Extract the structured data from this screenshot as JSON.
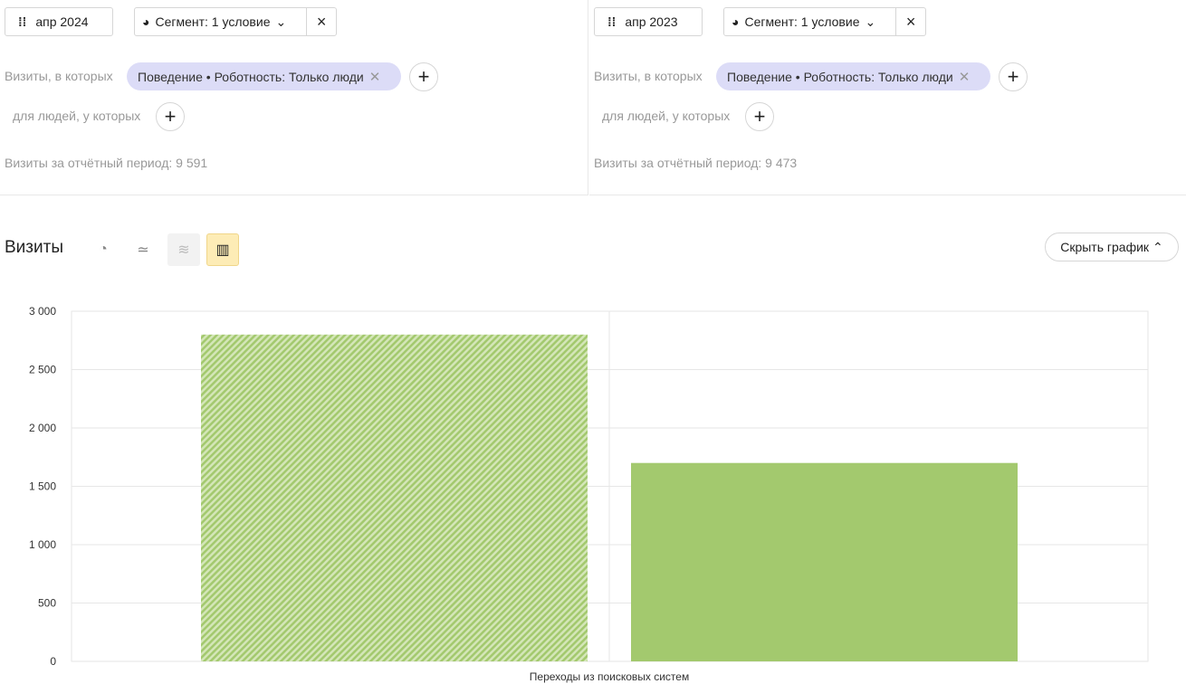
{
  "panels": [
    {
      "date": "апр 2024",
      "segment": "Сегмент: 1 условие",
      "visits_where": "Визиты, в которых",
      "chip": "Поведение • Роботность: Только люди",
      "people_where": "для людей, у которых",
      "total": "Визиты за отчётный период: 9 591"
    },
    {
      "date": "апр 2023",
      "segment": "Сегмент: 1 условие",
      "visits_where": "Визиты, в которых",
      "chip": "Поведение • Роботность: Только люди",
      "people_where": "для людей, у которых",
      "total": "Визиты за отчётный период: 9 473"
    }
  ],
  "chart_header": {
    "title": "Визиты",
    "hide_label": "Скрыть график"
  },
  "chart_data": {
    "type": "bar",
    "title": "Визиты",
    "categories": [
      "Переходы из поисковых систем"
    ],
    "series": [
      {
        "name": "апр 2024",
        "values": [
          2800
        ],
        "color": "#a3c96e",
        "pattern": "hatched"
      },
      {
        "name": "апр 2023",
        "values": [
          1700
        ],
        "color": "#a3c96e",
        "pattern": "solid"
      }
    ],
    "ylim": [
      0,
      3000
    ],
    "yticks": [
      0,
      500,
      1000,
      1500,
      2000,
      2500,
      3000
    ],
    "ytick_labels": [
      "0",
      "500",
      "1 000",
      "1 500",
      "2 000",
      "2 500",
      "3 000"
    ],
    "grid": true
  }
}
